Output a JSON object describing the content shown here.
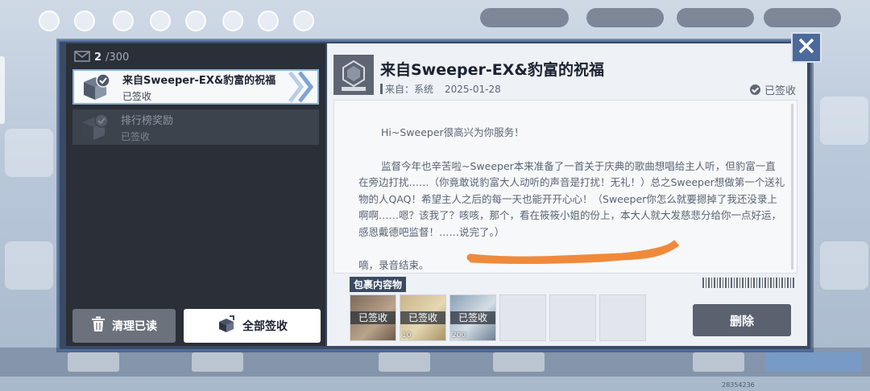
{
  "background": {
    "footer_code": "28354236"
  },
  "mailbox": {
    "count_current": "2",
    "count_total": "/300",
    "items": [
      {
        "title": "来自Sweeper-EX&豹富的祝福",
        "status": "已签收",
        "selected": true
      },
      {
        "title": "排行榜奖励",
        "status": "已签收",
        "selected": false
      }
    ],
    "clear_read_label": "清理已读",
    "claim_all_label": "全部签收"
  },
  "mail": {
    "title": "来自Sweeper-EX&豹富的祝福",
    "from_label": "来自：系统",
    "date": "2025-01-28",
    "signed_label": "已签收",
    "body": {
      "greeting": "Hi~Sweeper很高兴为你服务！",
      "paragraph": "监督今年也辛苦啦~Sweeper本来准备了一首关于庆典的歌曲想唱给主人听，但豹富一直在旁边打扰……（你竟敢说豹富大人动听的声音是打扰！无礼！）总之Sweeper想做第一个送礼物的人QAQ！希望主人之后的每一天也能开开心心！（Sweeper你怎么就要摁掉了我还没录上啊啊……嗯？该我了？咳咳，那个，看在筱筱小姐的份上，本大人就大发慈悲分给你一点好运，感恩戴德吧监督！……说完了。）",
      "closing": "嘀，录音结束。"
    },
    "contents_label": "包裹内容物",
    "attachments": [
      {
        "status": "已签收",
        "qty": ""
      },
      {
        "status": "已签收",
        "qty": "10"
      },
      {
        "status": "已签收",
        "qty": "200"
      }
    ],
    "delete_label": "删除"
  },
  "colors": {
    "panel_dark": "#2a2f38",
    "frame": "#3a4a63",
    "accent_blue": "#4c6a99",
    "scribble": "#ef8a3c"
  },
  "icons": [
    "mail-icon",
    "mail-check-icon",
    "trash-icon",
    "claim-box-icon",
    "check-circle-icon",
    "close-icon",
    "logo-icon"
  ]
}
